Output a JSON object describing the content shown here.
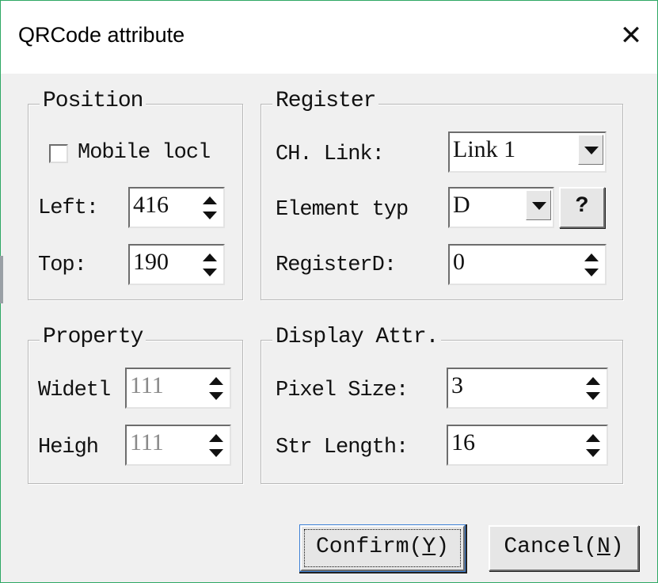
{
  "window": {
    "title": "QRCode attribute",
    "close_glyph": "✕"
  },
  "position": {
    "legend": "Position",
    "mobile_lock_label": "Mobile locl",
    "mobile_lock_checked": false,
    "left_label": "Left:",
    "left_value": "416",
    "top_label": "Top:",
    "top_value": "190"
  },
  "register": {
    "legend": "Register",
    "ch_link_label": "CH. Link:",
    "ch_link_value": "Link 1",
    "element_type_label": "Element typ",
    "element_type_value": "D",
    "help_button": "?",
    "register_label": "RegisterD:",
    "register_value": "0"
  },
  "property": {
    "legend": "Property",
    "width_label": "Widetl",
    "width_value": "111",
    "height_label": "Heigh",
    "height_value": "111"
  },
  "display": {
    "legend": "Display Attr.",
    "pixel_size_label": "Pixel Size:",
    "pixel_size_value": "3",
    "str_length_label": "Str Length:",
    "str_length_value": "16"
  },
  "buttons": {
    "confirm_prefix": "Confirm(",
    "confirm_key": "Y",
    "confirm_suffix": ")",
    "cancel_prefix": "Cancel(",
    "cancel_key": "N",
    "cancel_suffix": ")"
  }
}
